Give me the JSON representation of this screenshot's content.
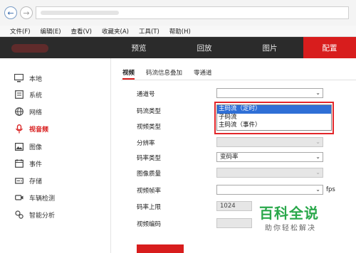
{
  "browser": {
    "menu": [
      "文件(F)",
      "编辑(E)",
      "查看(V)",
      "收藏夹(A)",
      "工具(T)",
      "帮助(H)"
    ]
  },
  "header": {
    "tabs": [
      "预览",
      "回放",
      "图片",
      "配置"
    ],
    "active_tab": "配置",
    "accent": "#d81d1d"
  },
  "sidebar": {
    "items": [
      {
        "label": "本地",
        "icon": "monitor-icon"
      },
      {
        "label": "系统",
        "icon": "system-icon"
      },
      {
        "label": "网络",
        "icon": "globe-icon"
      },
      {
        "label": "视音频",
        "icon": "microphone-icon"
      },
      {
        "label": "图像",
        "icon": "image-icon"
      },
      {
        "label": "事件",
        "icon": "calendar-icon"
      },
      {
        "label": "存储",
        "icon": "storage-icon"
      },
      {
        "label": "车辆检测",
        "icon": "camera-icon"
      },
      {
        "label": "智能分析",
        "icon": "analysis-icon"
      }
    ],
    "active": "视音频"
  },
  "subtabs": [
    "视频",
    "码流信息叠加",
    "零通道"
  ],
  "form": {
    "channel_label": "通道号",
    "stream_type_label": "码流类型",
    "video_type_label": "视频类型",
    "resolution_label": "分辨率",
    "bitrate_type_label": "码率类型",
    "bitrate_type_value": "变码率",
    "image_quality_label": "图像质量",
    "framerate_label": "视频帧率",
    "framerate_unit": "fps",
    "bitrate_limit_label": "码率上限",
    "bitrate_limit_value": "1024",
    "video_encoding_label": "视频编码"
  },
  "dropdown": {
    "options": [
      "主码流（定时）",
      "子码流",
      "主码流（事件）"
    ],
    "highlighted": "主码流（定时）"
  },
  "watermark": {
    "title": "百科全说",
    "subtitle": "助你轻松解决"
  }
}
